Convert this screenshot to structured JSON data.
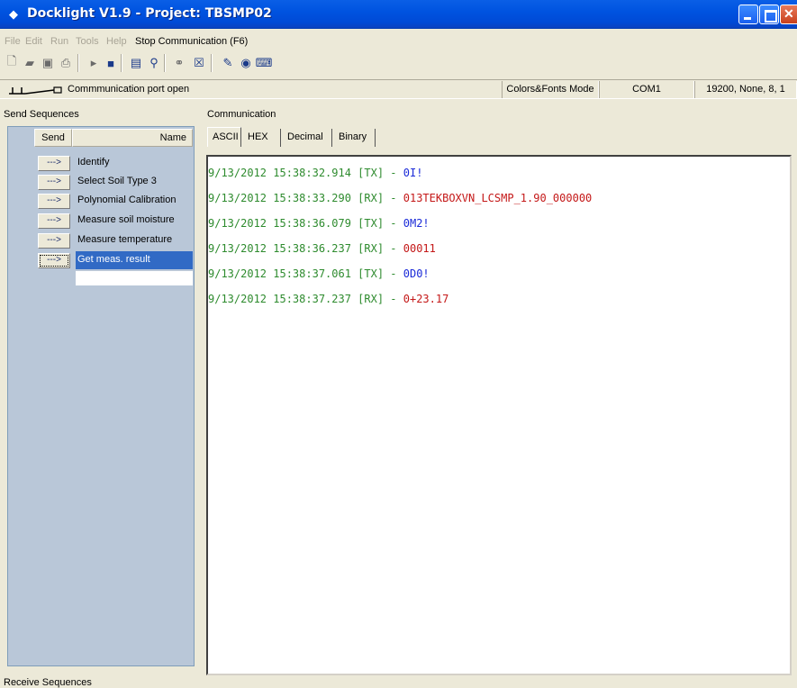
{
  "window": {
    "title": "Docklight V1.9 - Project: TBSMP02"
  },
  "menu": {
    "items": [
      "File",
      "Edit",
      "Run",
      "Tools",
      "Help"
    ],
    "stop_comm": "Stop Communication  (F6)"
  },
  "toolbar": {
    "icons": [
      "new-file-icon",
      "open-folder-icon",
      "save-icon",
      "print-icon",
      "play-icon",
      "stop-icon",
      "properties-icon",
      "port-settings-icon",
      "find-icon",
      "clear-icon",
      "script-edit-icon",
      "capture-icon",
      "keyboard-icon"
    ]
  },
  "status": {
    "port_text": "Commmunication port open",
    "mode": "Colors&Fonts Mode",
    "port": "COM1",
    "settings": "19200, None, 8, 1"
  },
  "send_panel": {
    "title": "Send Sequences",
    "header_send": "Send",
    "header_name": "Name",
    "button_label": "--->",
    "sequences": [
      {
        "name": "Identify"
      },
      {
        "name": "Select Soil Type 3"
      },
      {
        "name": "Polynomial Calibration"
      },
      {
        "name": "Measure soil moisture"
      },
      {
        "name": "Measure temperature"
      },
      {
        "name": "Get meas. result"
      }
    ]
  },
  "receive_panel": {
    "title": "Receive Sequences"
  },
  "comm_panel": {
    "title": "Communication",
    "tabs": [
      "ASCII",
      "HEX",
      "Decimal",
      "Binary"
    ],
    "lines": [
      {
        "ts": "9/13/2012 15:38:32.914 [TX] - ",
        "data": "0I!",
        "dir": "tx"
      },
      {
        "ts": "9/13/2012 15:38:33.290 [RX] - ",
        "data": "013TEKBOXVN_LCSMP_1.90_000000",
        "dir": "rx"
      },
      {
        "ts": "9/13/2012 15:38:36.079 [TX] - ",
        "data": "0M2!",
        "dir": "tx"
      },
      {
        "ts": "9/13/2012 15:38:36.237 [RX] - ",
        "data": "00011",
        "dir": "rx"
      },
      {
        "ts": "9/13/2012 15:38:37.061 [TX] - ",
        "data": "0D0!",
        "dir": "tx"
      },
      {
        "ts": "9/13/2012 15:38:37.237 [RX] - ",
        "data": "0+23.17",
        "dir": "rx"
      }
    ]
  },
  "colors": {
    "title_bar": "#0053e0",
    "timestamp": "#2e8b2e",
    "tx": "#1a2ad8",
    "rx": "#c41818",
    "selection": "#316ac5"
  }
}
